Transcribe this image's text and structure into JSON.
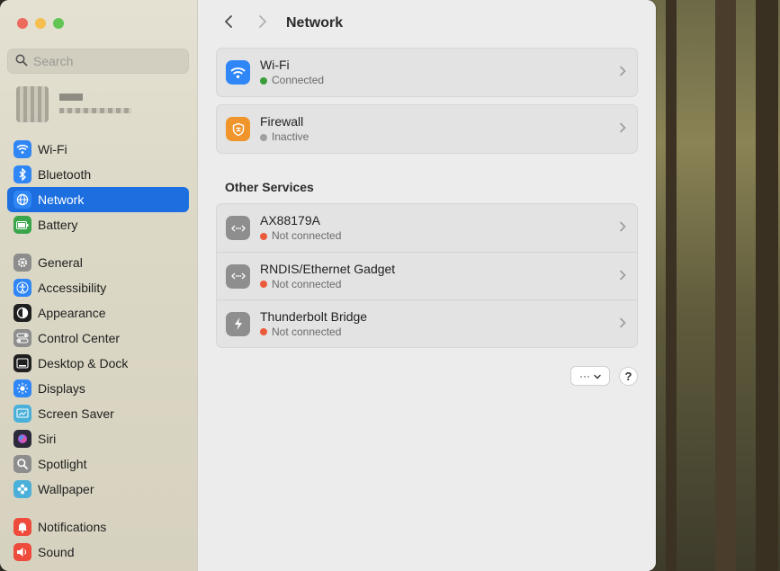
{
  "search": {
    "placeholder": "Search"
  },
  "sidebar": {
    "items": [
      {
        "label": "Wi-Fi",
        "icon": "wifi-icon",
        "color": "#2f86f6"
      },
      {
        "label": "Bluetooth",
        "icon": "bluetooth-icon",
        "color": "#2f86f6"
      },
      {
        "label": "Network",
        "icon": "globe-icon",
        "color": "#2f86f6",
        "active": true
      },
      {
        "label": "Battery",
        "icon": "battery-icon",
        "color": "#3aa54a"
      },
      {
        "label": "General",
        "icon": "gear-icon",
        "color": "#8d8d8d"
      },
      {
        "label": "Accessibility",
        "icon": "accessibility-icon",
        "color": "#2f86f6"
      },
      {
        "label": "Appearance",
        "icon": "appearance-icon",
        "color": "#1f1f1f"
      },
      {
        "label": "Control Center",
        "icon": "control-center-icon",
        "color": "#8d8d8d"
      },
      {
        "label": "Desktop & Dock",
        "icon": "desktop-dock-icon",
        "color": "#1f1f1f"
      },
      {
        "label": "Displays",
        "icon": "displays-icon",
        "color": "#2f86f6"
      },
      {
        "label": "Screen Saver",
        "icon": "screen-saver-icon",
        "color": "#4ab0d9"
      },
      {
        "label": "Siri",
        "icon": "siri-icon",
        "color": "#2a2a3a"
      },
      {
        "label": "Spotlight",
        "icon": "spotlight-icon",
        "color": "#8d8d8d"
      },
      {
        "label": "Wallpaper",
        "icon": "wallpaper-icon",
        "color": "#4ab0d9"
      },
      {
        "label": "Notifications",
        "icon": "notifications-icon",
        "color": "#ee4b3c"
      },
      {
        "label": "Sound",
        "icon": "sound-icon",
        "color": "#ee4b3c"
      }
    ]
  },
  "header": {
    "title": "Network"
  },
  "services": [
    {
      "title": "Wi-Fi",
      "status": "Connected",
      "status_color": "#3a9d3a",
      "icon": "wifi-icon",
      "icon_color": "#2f86f6"
    }
  ],
  "firewall": {
    "title": "Firewall",
    "status": "Inactive",
    "status_color": "#a0a0a0",
    "icon": "firewall-icon",
    "icon_color": "#f0952c"
  },
  "other_services": {
    "title": "Other Services",
    "items": [
      {
        "title": "AX88179A",
        "status": "Not connected",
        "status_color": "#ea5a3b",
        "icon": "ethernet-icon",
        "icon_color": "#8e8e8e"
      },
      {
        "title": "RNDIS/Ethernet Gadget",
        "status": "Not connected",
        "status_color": "#ea5a3b",
        "icon": "ethernet-icon",
        "icon_color": "#8e8e8e"
      },
      {
        "title": "Thunderbolt Bridge",
        "status": "Not connected",
        "status_color": "#ea5a3b",
        "icon": "thunderbolt-icon",
        "icon_color": "#8e8e8e"
      }
    ]
  },
  "actions": {
    "more_label": "···",
    "help_label": "?"
  }
}
